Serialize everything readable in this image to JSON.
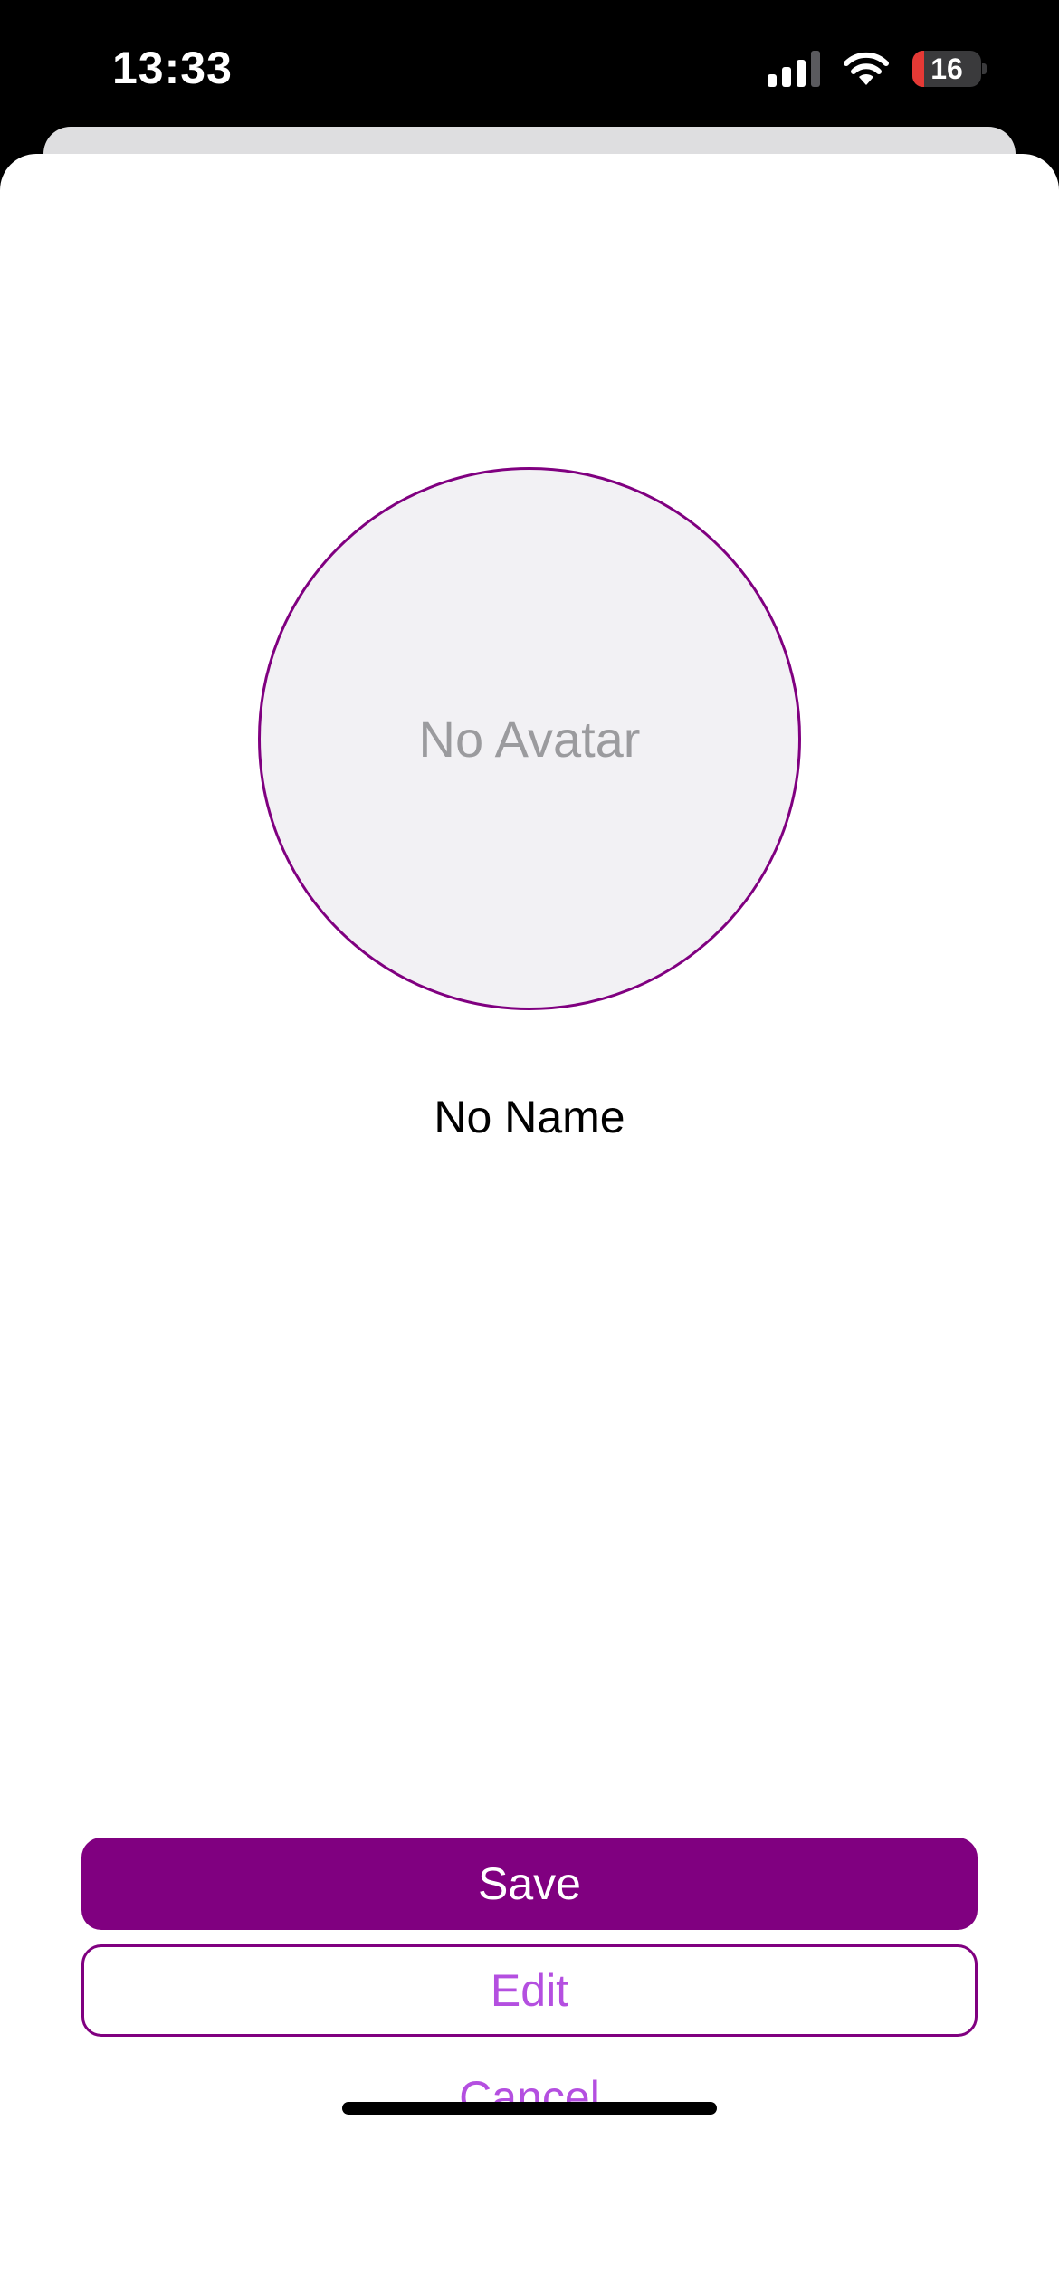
{
  "status_bar": {
    "time": "13:33",
    "battery_level": "16",
    "icons": [
      "signal-icon",
      "wifi-icon",
      "battery-icon"
    ]
  },
  "profile": {
    "avatar_placeholder": "No Avatar",
    "name": "No Name"
  },
  "actions": {
    "save_label": "Save",
    "edit_label": "Edit",
    "cancel_label": "Cancel"
  },
  "colors": {
    "accent": "#800080",
    "accent_text": "#b44fe0",
    "avatar_background": "#f2f1f4",
    "battery_low": "#e53935"
  }
}
